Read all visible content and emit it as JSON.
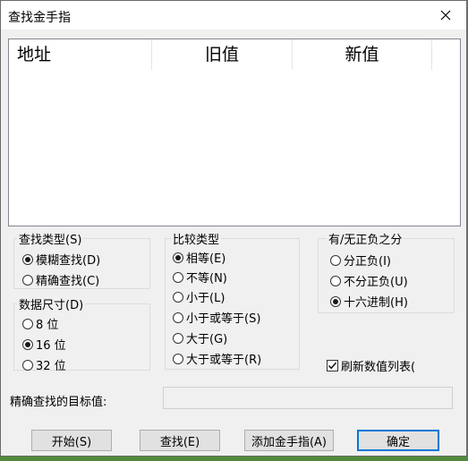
{
  "window": {
    "title": "查找金手指"
  },
  "list": {
    "columns": [
      "地址",
      "旧值",
      "新值"
    ]
  },
  "search_type": {
    "label": "查找类型(S)",
    "options": [
      {
        "label": "模糊查找(D)",
        "selected": true
      },
      {
        "label": "精确查找(C)",
        "selected": false
      }
    ]
  },
  "data_size": {
    "label": "数据尺寸(D)",
    "options": [
      {
        "label": "8 位",
        "selected": false
      },
      {
        "label": "16 位",
        "selected": true
      },
      {
        "label": "32 位",
        "selected": false
      }
    ]
  },
  "compare_type": {
    "label": "比较类型",
    "options": [
      {
        "label": "相等(E)",
        "selected": true
      },
      {
        "label": "不等(N)",
        "selected": false
      },
      {
        "label": "小于(L)",
        "selected": false
      },
      {
        "label": "小于或等于(S)",
        "selected": false
      },
      {
        "label": "大于(G)",
        "selected": false
      },
      {
        "label": "大于或等于(R)",
        "selected": false
      }
    ]
  },
  "sign": {
    "label": "有/无正负之分",
    "options": [
      {
        "label": "分正负(I)",
        "selected": false
      },
      {
        "label": "不分正负(U)",
        "selected": false
      },
      {
        "label": "十六进制(H)",
        "selected": true
      }
    ]
  },
  "refresh": {
    "label": "刷新数值列表(",
    "checked": true
  },
  "target": {
    "label": "精确查找的目标值:",
    "value": ""
  },
  "buttons": {
    "start": "开始(S)",
    "find": "查找(E)",
    "add_cheat": "添加金手指(A)",
    "ok": "确定"
  }
}
